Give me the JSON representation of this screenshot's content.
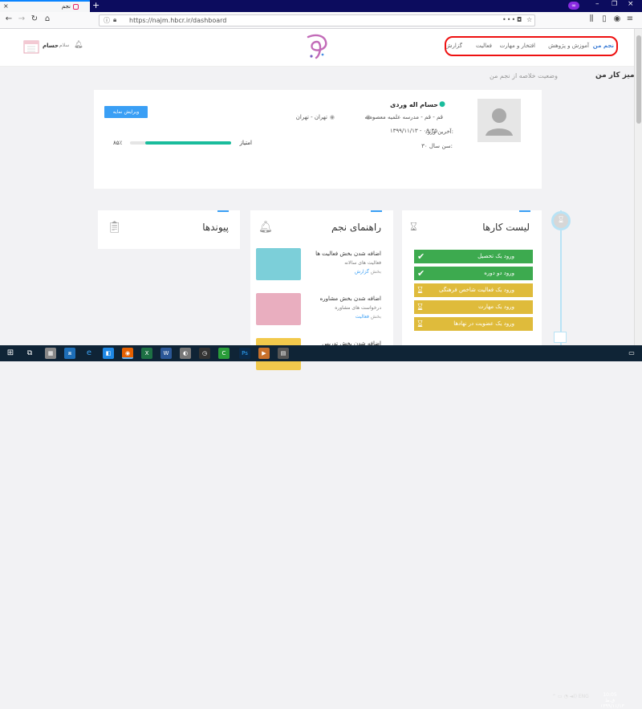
{
  "browser": {
    "tab_title": "نجم",
    "tab_close": "×",
    "new_tab": "+",
    "url": "https://najm.hbcr.ir/dashboard",
    "url_dots": "•••",
    "private_badge": "∞",
    "window_min": "–",
    "window_max": "❐",
    "window_close": "×"
  },
  "header": {
    "menu": [
      "نجم من",
      "آموزش و پژوهش",
      "افتخار و مهارت",
      "فعالیت",
      "گزارش"
    ],
    "user_name": "حسام",
    "user_prefix": "سلام",
    "logo_text": "نجم"
  },
  "page": {
    "title": "میز کار من",
    "subtitle": "وضعیت خلاصه از نجم من"
  },
  "profile": {
    "name": "حسام اله وردی",
    "location": "قم - قم - مدرسه علمیه معصومیه",
    "city": "تهران - تهران",
    "last_login_label": "آخرین ورود:",
    "last_login": "۱۳۹۹/۱۱/۱۳ - ۰۹:۴۵",
    "age_label": "سن:",
    "age": "۳۰ سال",
    "edit_label": "ویرایش نمایه",
    "score_label": "امتیاز",
    "score_percent": "۸۵٪",
    "score_fraction": 0.85
  },
  "cards": {
    "tasks": {
      "title": "لیست کارها",
      "items": [
        {
          "label": "ورود یک تحصیل",
          "status": "done",
          "color": "#3daa4f"
        },
        {
          "label": "ورود دو دوره",
          "status": "done",
          "color": "#3daa4f"
        },
        {
          "label": "ورود یک فعالیت شاخص فرهنگی",
          "status": "pending",
          "color": "#dfbb3b"
        },
        {
          "label": "ورود یک مهارت",
          "status": "pending",
          "color": "#dfbb3b"
        },
        {
          "label": "ورود یک عضویت در نهادها",
          "status": "pending",
          "color": "#dfbb3b"
        }
      ]
    },
    "guide": {
      "title": "راهنمای نجم",
      "items": [
        {
          "title": "اضافه شدن بخش فعالیت ها",
          "desc": "فعالیت های سالانه",
          "section_label": "بخش",
          "section": "گزارش",
          "color": "#7ccfd9"
        },
        {
          "title": "اضافه شدن بخش مشاوره",
          "desc": "درخواست های مشاوره",
          "section_label": "بخش",
          "section": "فعالیت",
          "color": "#e9aebf"
        },
        {
          "title": "اضافه شدن بخش تدریس",
          "desc": "",
          "section_label": "",
          "section": "",
          "color": "#f2c94c"
        }
      ]
    },
    "links": {
      "title": "پیوندها"
    }
  },
  "taskbar": {
    "lang": "ENG",
    "time": "10:05 ق.ظ",
    "date": "۱۳۹۹/۱۱/۱۳"
  }
}
